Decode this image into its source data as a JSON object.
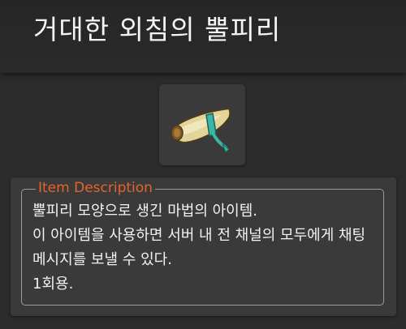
{
  "item": {
    "title": "거대한 외침의 뿔피리",
    "icon": "horn-icon"
  },
  "description": {
    "legend": "Item Description",
    "text": "뿔피리 모양으로 생긴 마법의 아이템.\n이 아이템을 사용하면 서버 내 전 채널의 모두에게 채팅 메시지를 보낼 수 있다.\n1회용.",
    "legend_color": "#e8632a"
  }
}
